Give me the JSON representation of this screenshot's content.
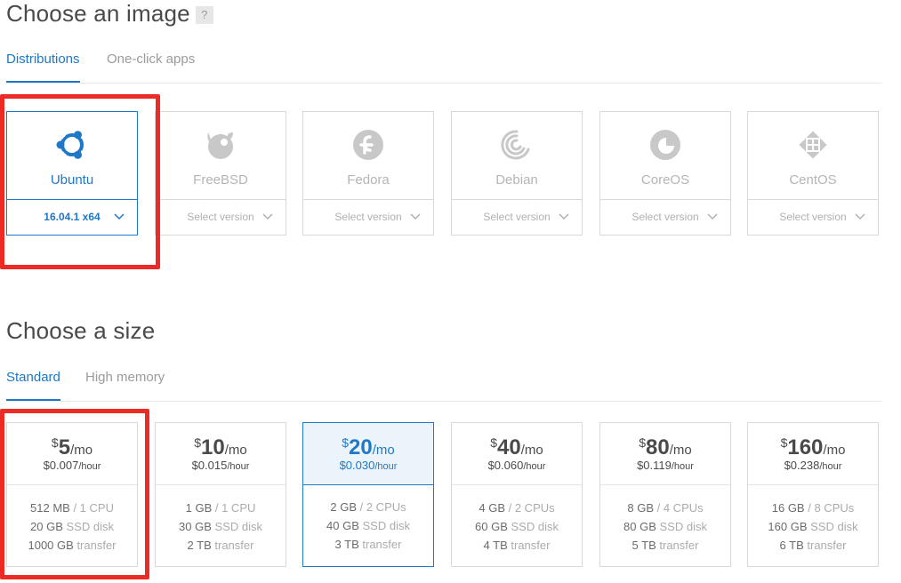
{
  "image_section": {
    "title": "Choose an image",
    "help": "?",
    "tabs": [
      {
        "label": "Distributions",
        "active": true
      },
      {
        "label": "One-click apps",
        "active": false
      }
    ],
    "distros": [
      {
        "name": "Ubuntu",
        "version": "16.04.1 x64",
        "icon": "ubuntu-icon",
        "selected": true
      },
      {
        "name": "FreeBSD",
        "version": "Select version",
        "icon": "freebsd-icon",
        "selected": false
      },
      {
        "name": "Fedora",
        "version": "Select version",
        "icon": "fedora-icon",
        "selected": false
      },
      {
        "name": "Debian",
        "version": "Select version",
        "icon": "debian-icon",
        "selected": false
      },
      {
        "name": "CoreOS",
        "version": "Select version",
        "icon": "coreos-icon",
        "selected": false
      },
      {
        "name": "CentOS",
        "version": "Select version",
        "icon": "centos-icon",
        "selected": false
      }
    ]
  },
  "size_section": {
    "title": "Choose a size",
    "tabs": [
      {
        "label": "Standard",
        "active": true
      },
      {
        "label": "High memory",
        "active": false
      }
    ],
    "plans": [
      {
        "dollar": "$",
        "amount": "5",
        "per_month": "/mo",
        "hourly": "$0.007",
        "per_hour": "/hour",
        "ram": "512 MB",
        "cpu": "/ 1 CPU",
        "disk": "20 GB",
        "disk_label": "SSD disk",
        "transfer": "1000 GB",
        "transfer_label": "transfer",
        "selected": false
      },
      {
        "dollar": "$",
        "amount": "10",
        "per_month": "/mo",
        "hourly": "$0.015",
        "per_hour": "/hour",
        "ram": "1 GB",
        "cpu": "/ 1 CPU",
        "disk": "30 GB",
        "disk_label": "SSD disk",
        "transfer": "2 TB",
        "transfer_label": "transfer",
        "selected": false
      },
      {
        "dollar": "$",
        "amount": "20",
        "per_month": "/mo",
        "hourly": "$0.030",
        "per_hour": "/hour",
        "ram": "2 GB",
        "cpu": "/ 2 CPUs",
        "disk": "40 GB",
        "disk_label": "SSD disk",
        "transfer": "3 TB",
        "transfer_label": "transfer",
        "selected": true
      },
      {
        "dollar": "$",
        "amount": "40",
        "per_month": "/mo",
        "hourly": "$0.060",
        "per_hour": "/hour",
        "ram": "4 GB",
        "cpu": "/ 2 CPUs",
        "disk": "60 GB",
        "disk_label": "SSD disk",
        "transfer": "4 TB",
        "transfer_label": "transfer",
        "selected": false
      },
      {
        "dollar": "$",
        "amount": "80",
        "per_month": "/mo",
        "hourly": "$0.119",
        "per_hour": "/hour",
        "ram": "8 GB",
        "cpu": "/ 4 CPUs",
        "disk": "80 GB",
        "disk_label": "SSD disk",
        "transfer": "5 TB",
        "transfer_label": "transfer",
        "selected": false
      },
      {
        "dollar": "$",
        "amount": "160",
        "per_month": "/mo",
        "hourly": "$0.238",
        "per_hour": "/hour",
        "ram": "16 GB",
        "cpu": "/ 8 CPUs",
        "disk": "160 GB",
        "disk_label": "SSD disk",
        "transfer": "6 TB",
        "transfer_label": "transfer",
        "selected": false
      }
    ]
  },
  "colors": {
    "accent": "#1e78c7",
    "highlight_box": "#ec2a26",
    "selected_bg": "#ebf4fb"
  }
}
